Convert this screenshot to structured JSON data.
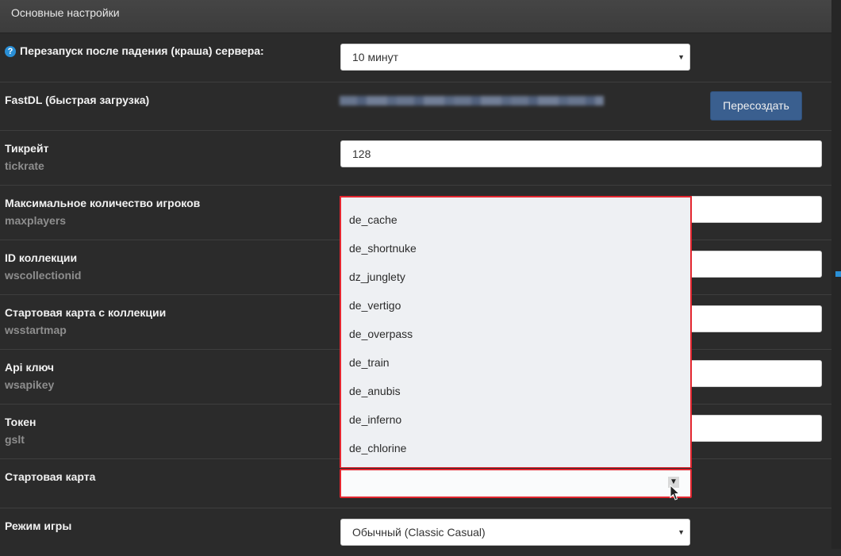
{
  "header": {
    "title": "Основные настройки"
  },
  "rows": {
    "restart": {
      "label": "Перезапуск после падения (краша) сервера:",
      "value": "10 минут"
    },
    "fastdl": {
      "label": "FastDL (быстрая загрузка)",
      "button": "Пересоздать"
    },
    "tickrate": {
      "label": "Тикрейт",
      "key": "tickrate",
      "value": "128"
    },
    "maxplayers": {
      "label": "Максимальное количество игроков",
      "key": "maxplayers"
    },
    "wscollectionid": {
      "label": "ID коллекции",
      "key": "wscollectionid"
    },
    "wsstartmap": {
      "label": "Стартовая карта с коллекции",
      "key": "wsstartmap"
    },
    "wsapikey": {
      "label": "Api ключ",
      "key": "wsapikey"
    },
    "gslt": {
      "label": "Токен",
      "key": "gslt"
    },
    "startmap": {
      "label": "Стартовая карта",
      "value": "",
      "options": [
        "de_cache",
        "de_shortnuke",
        "dz_junglety",
        "de_vertigo",
        "de_overpass",
        "de_train",
        "de_anubis",
        "de_inferno",
        "de_chlorine"
      ]
    },
    "gamemode": {
      "label": "Режим игры",
      "value": "Обычный (Classic Casual)"
    }
  },
  "icons": {
    "help": "help-circle-icon",
    "caret": "caret-down-icon",
    "cursor": "mouse-pointer-icon"
  },
  "colors": {
    "accent": "#2a8fd6",
    "highlight": "#e3262f",
    "button": "#3a5f8f"
  }
}
